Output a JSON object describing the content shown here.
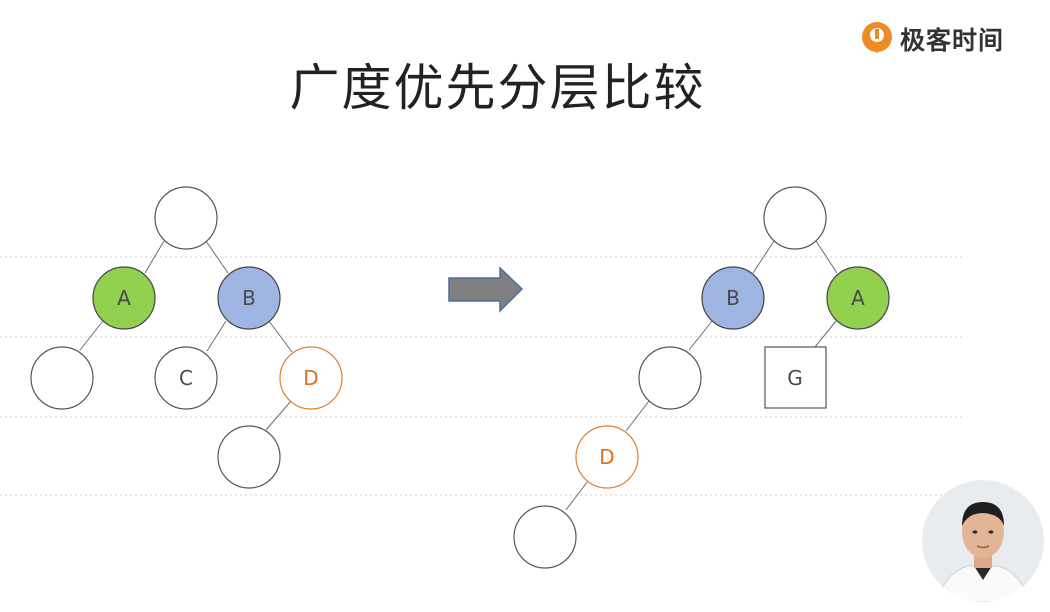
{
  "slide": {
    "title": "广度优先分层比较",
    "logo_text": "极客时间",
    "logo_icon": "geektime-logo-icon",
    "presenter_icon": "presenter-video-icon"
  },
  "colors": {
    "node_green": "#92d050",
    "node_blue": "#9eb4e2",
    "node_orange_stroke": "#e0812a",
    "node_orange_text": "#d9721e",
    "arrow_fill": "#7f7f7f",
    "arrow_stroke": "#4a6fa5",
    "logo_orange": "#f08a24"
  },
  "left_tree": {
    "labels": {
      "A": "A",
      "B": "B",
      "C": "C",
      "D": "D"
    }
  },
  "right_tree": {
    "labels": {
      "B": "B",
      "A": "A",
      "D": "D",
      "G": "G"
    }
  }
}
